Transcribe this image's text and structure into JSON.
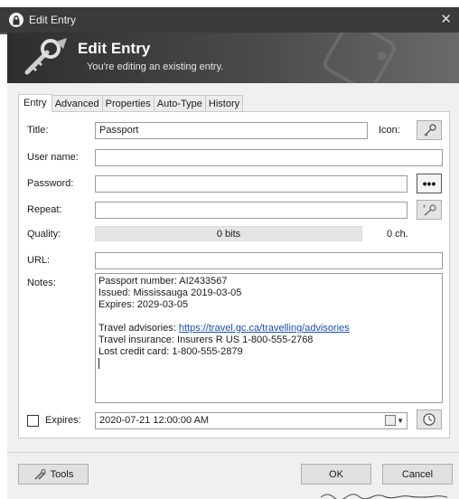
{
  "window": {
    "title": "Edit Entry",
    "app_icon": "keepass-lock-icon"
  },
  "banner": {
    "title": "Edit Entry",
    "subtitle": "You're editing an existing entry."
  },
  "tabs": [
    {
      "label": "Entry",
      "active": true
    },
    {
      "label": "Advanced"
    },
    {
      "label": "Properties"
    },
    {
      "label": "Auto-Type"
    },
    {
      "label": "History"
    }
  ],
  "form": {
    "title_label": "Title:",
    "title_value": "Passport",
    "icon_label": "Icon:",
    "username_label": "User name:",
    "username_value": "",
    "password_label": "Password:",
    "password_value": "",
    "repeat_label": "Repeat:",
    "repeat_value": "",
    "quality_label": "Quality:",
    "quality_value": "0 bits",
    "quality_chars": "0 ch.",
    "url_label": "URL:",
    "url_value": "",
    "notes_label": "Notes:",
    "notes_lines": [
      "Passport number: AI2433567",
      "Issued: Mississauga 2019-03-05",
      "Expires: 2029-03-05",
      "",
      "Travel advisories: ",
      "Travel insurance: Insurers R US 1-800-555-2768",
      "Lost credit card: 1-800-555-2879"
    ],
    "notes_link": "https://travel.gc.ca/travelling/advisories",
    "expires_label": "Expires:",
    "expires_checked": false,
    "expires_value": "2020-07-21 12:00:00 AM"
  },
  "buttons": {
    "show_password": "•••",
    "tools": "Tools",
    "ok": "OK",
    "cancel": "Cancel"
  },
  "colors": {
    "banner_dark": "#2e2e2e",
    "titlebar": "#3a3a3a",
    "link": "#1a4fb0"
  }
}
